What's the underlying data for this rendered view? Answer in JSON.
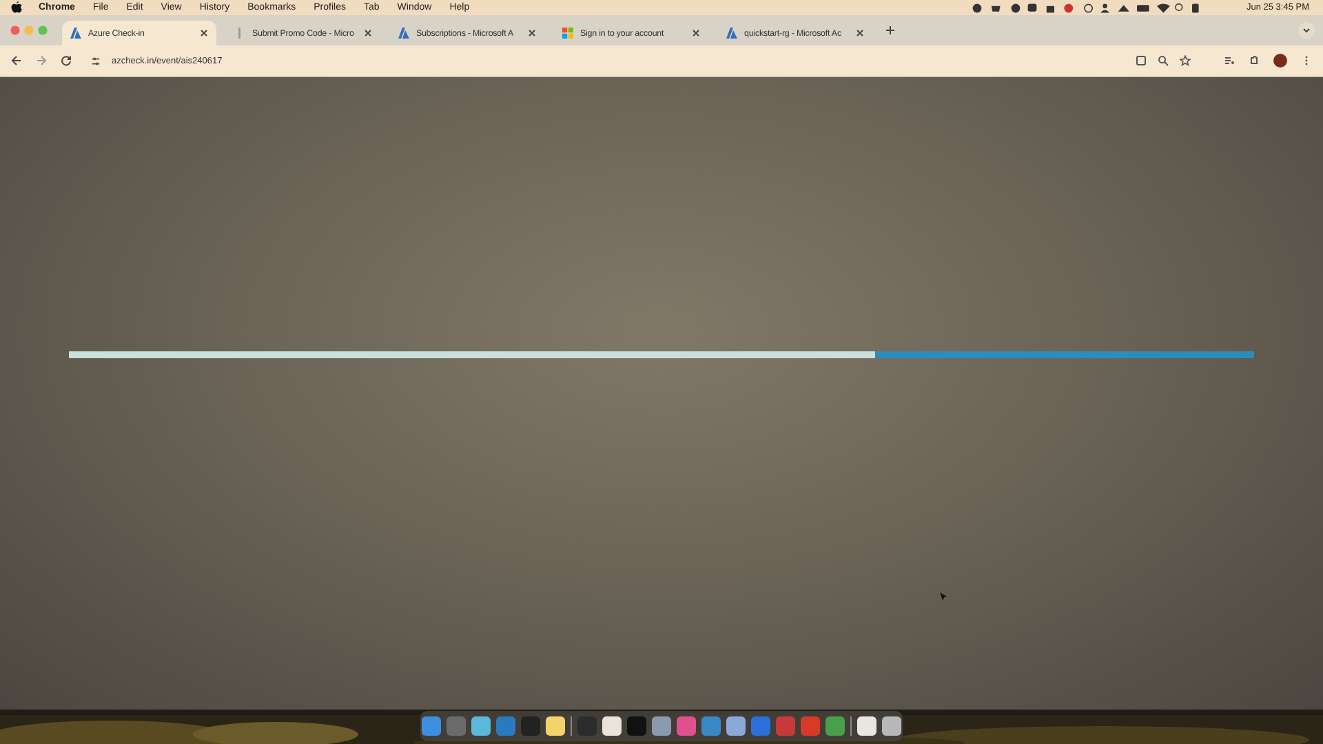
{
  "menu_bar": {
    "items": [
      {
        "label": "Chrome",
        "bold": true
      },
      {
        "label": "File",
        "bold": false
      },
      {
        "label": "Edit",
        "bold": false
      },
      {
        "label": "View",
        "bold": false
      },
      {
        "label": "History",
        "bold": false
      },
      {
        "label": "Bookmarks",
        "bold": false
      },
      {
        "label": "Profiles",
        "bold": false
      },
      {
        "label": "Tab",
        "bold": false
      },
      {
        "label": "Window",
        "bold": false
      },
      {
        "label": "Help",
        "bold": false
      }
    ],
    "clock": "Jun 25  3:45 PM"
  },
  "tabs": [
    {
      "title": "Azure Check-in",
      "selected": true,
      "kind": "azure"
    },
    {
      "title": "Submit Promo Code - Micro",
      "selected": false,
      "kind": "page"
    },
    {
      "title": "Subscriptions - Microsoft A",
      "selected": false,
      "kind": "azure"
    },
    {
      "title": "Sign in to your account",
      "selected": false,
      "kind": "microsoft"
    },
    {
      "title": "quickstart-rg - Microsoft Ac",
      "selected": false,
      "kind": "azure"
    }
  ],
  "address_bar": {
    "url": "azcheck.in/event/ais240617"
  },
  "progress": {
    "level": 0.68
  },
  "dock": [
    {
      "color": "#3d8fe0"
    },
    {
      "color": "#6b6b6b"
    },
    {
      "color": "#5ab8d8"
    },
    {
      "color": "#2a7ac0"
    },
    {
      "color": "#222222"
    },
    {
      "color": "#f2d46a"
    },
    {
      "color": "#2c2c2c"
    },
    {
      "color": "#e8e4dc"
    },
    {
      "color": "#111111"
    },
    {
      "color": "#8a9ab0"
    },
    {
      "color": "#e0508c"
    },
    {
      "color": "#3a88c8"
    },
    {
      "color": "#8aa8d8"
    },
    {
      "color": "#2a70d8"
    },
    {
      "color": "#c83a3a"
    },
    {
      "color": "#d83a2a"
    },
    {
      "color": "#4aa04a"
    },
    {
      "color": "#e8e6e0"
    },
    {
      "color": "#b8b8b8"
    }
  ]
}
